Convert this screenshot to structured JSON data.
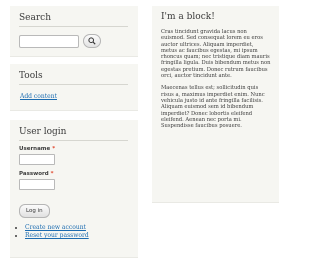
{
  "search": {
    "title": "Search",
    "input_value": "",
    "button_icon": "search-icon"
  },
  "tools": {
    "title": "Tools",
    "link": "Add content"
  },
  "login": {
    "title": "User login",
    "username_label": "Username",
    "password_label": "Password",
    "required_mark": "*",
    "button": "Log in",
    "links": [
      "Create new account",
      "Reset your password"
    ]
  },
  "block": {
    "title": "I'm a block!",
    "paragraphs": [
      "Cras tincidunt gravida lacus non euismod. Sed consequat lorem eu eros auctor ultrices. Aliquam imperdiet, metus ac faucibus egestas, mi ipsum rhoncus quam; nec tristique diam mauris fringilla ligula. Duis bibendum metus non egestas pretium. Donec rutrum faucibus orci, auctor tincidunt ante.",
      "Maecenas tellus est; sollicitudin quis risus a, maximus imperdiet enim. Nunc vehicula justo id ante fringilla facilisis. Aliquam euismod sem id bibendum imperdiet? Donec lobortis eleifend eleifend. Aenean nec porta mi. Suspendisse faucibus posuere."
    ]
  },
  "colors": {
    "block_bg": "#f6f6f2",
    "link": "#1b6bb0",
    "required": "#e0452a"
  }
}
